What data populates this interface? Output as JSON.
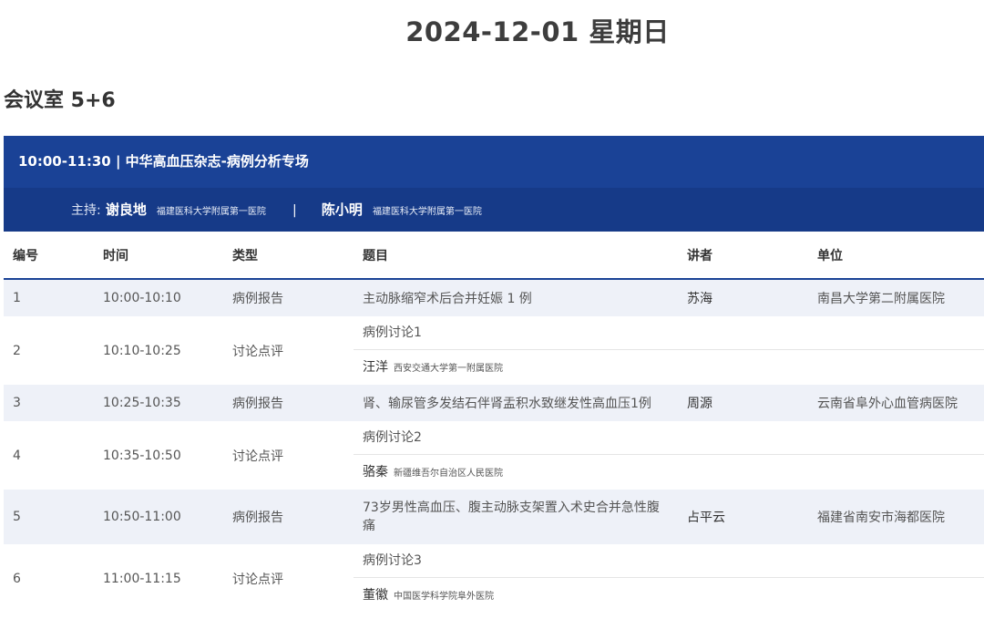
{
  "page": {
    "date_title": "2024-12-01 星期日",
    "room": "会议室 5+6"
  },
  "session": {
    "title": "10:00-11:30 | 中华高血压杂志-病例分析专场",
    "host_label": "主持:",
    "hosts": [
      {
        "name": "谢良地",
        "institution": "福建医科大学附属第一医院"
      },
      {
        "name": "陈小明",
        "institution": "福建医科大学附属第一医院"
      }
    ],
    "separator": "|"
  },
  "table": {
    "headers": [
      "编号",
      "时间",
      "类型",
      "题目",
      "讲者",
      "单位"
    ],
    "rows": [
      {
        "no": "1",
        "time": "10:00-10:10",
        "type": "病例报告",
        "topic": "主动脉缩窄术后合并妊娠 1 例",
        "speaker": "苏海",
        "unit": "南昌大学第二附属医院"
      },
      {
        "no": "2",
        "time": "10:10-10:25",
        "type": "讨论点评",
        "topic": "病例讨论1",
        "panel_name": "汪洋",
        "panel_inst": "西安交通大学第一附属医院"
      },
      {
        "no": "3",
        "time": "10:25-10:35",
        "type": "病例报告",
        "topic": "肾、输尿管多发结石伴肾盂积水致继发性高血压1例",
        "speaker": "周源",
        "unit": "云南省阜外心血管病医院"
      },
      {
        "no": "4",
        "time": "10:35-10:50",
        "type": "讨论点评",
        "topic": "病例讨论2",
        "panel_name": "骆秦",
        "panel_inst": "新疆维吾尔自治区人民医院"
      },
      {
        "no": "5",
        "time": "10:50-11:00",
        "type": "病例报告",
        "topic": "73岁男性高血压、腹主动脉支架置入术史合并急性腹痛",
        "speaker": "占平云",
        "unit": "福建省南安市海都医院"
      },
      {
        "no": "6",
        "time": "11:00-11:15",
        "type": "讨论点评",
        "topic": "病例讨论3",
        "panel_name": "董徽",
        "panel_inst": "中国医学科学院阜外医院"
      }
    ]
  },
  "colors": {
    "header_blue": "#1a4296",
    "host_bar_blue": "#163a88",
    "row_shade": "#eef1f8"
  }
}
